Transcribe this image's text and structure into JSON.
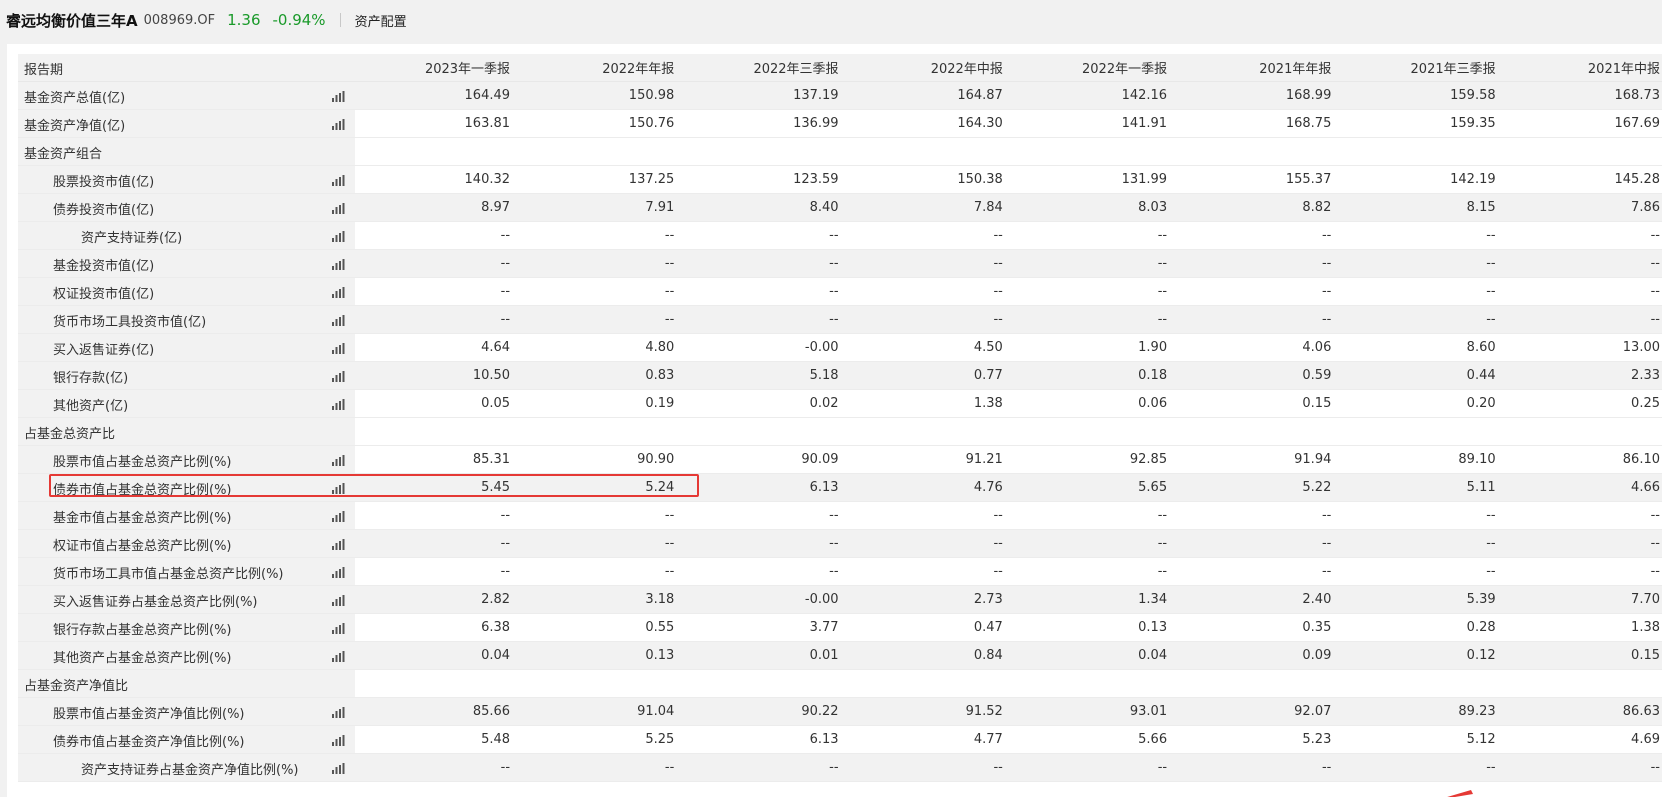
{
  "header": {
    "fund_name": "睿远均衡价值三年A",
    "fund_code": "008969.OF",
    "price": "1.36",
    "change": "-0.94%",
    "section_title": "资产配置",
    "price_color": "#1a9a2a"
  },
  "table": {
    "header_label": "报告期",
    "columns": [
      "2023年一季报",
      "2022年年报",
      "2022年三季报",
      "2022年中报",
      "2022年一季报",
      "2021年年报",
      "2021年三季报",
      "2021年中报"
    ],
    "rows": [
      {
        "label": "基金资产总值(亿)",
        "level": 0,
        "values": [
          "164.49",
          "150.98",
          "137.19",
          "164.87",
          "142.16",
          "168.99",
          "159.58",
          "168.73"
        ]
      },
      {
        "label": "基金资产净值(亿)",
        "level": 0,
        "values": [
          "163.81",
          "150.76",
          "136.99",
          "164.30",
          "141.91",
          "168.75",
          "159.35",
          "167.69"
        ]
      },
      {
        "label": "基金资产组合",
        "level": 0,
        "group": true
      },
      {
        "label": "股票投资市值(亿)",
        "level": 1,
        "values": [
          "140.32",
          "137.25",
          "123.59",
          "150.38",
          "131.99",
          "155.37",
          "142.19",
          "145.28"
        ]
      },
      {
        "label": "债券投资市值(亿)",
        "level": 1,
        "values": [
          "8.97",
          "7.91",
          "8.40",
          "7.84",
          "8.03",
          "8.82",
          "8.15",
          "7.86"
        ]
      },
      {
        "label": "资产支持证券(亿)",
        "level": 2,
        "values": [
          "--",
          "--",
          "--",
          "--",
          "--",
          "--",
          "--",
          "--"
        ]
      },
      {
        "label": "基金投资市值(亿)",
        "level": 1,
        "values": [
          "--",
          "--",
          "--",
          "--",
          "--",
          "--",
          "--",
          "--"
        ]
      },
      {
        "label": "权证投资市值(亿)",
        "level": 1,
        "values": [
          "--",
          "--",
          "--",
          "--",
          "--",
          "--",
          "--",
          "--"
        ]
      },
      {
        "label": "货币市场工具投资市值(亿)",
        "level": 1,
        "values": [
          "--",
          "--",
          "--",
          "--",
          "--",
          "--",
          "--",
          "--"
        ]
      },
      {
        "label": "买入返售证券(亿)",
        "level": 1,
        "values": [
          "4.64",
          "4.80",
          "-0.00",
          "4.50",
          "1.90",
          "4.06",
          "8.60",
          "13.00"
        ]
      },
      {
        "label": "银行存款(亿)",
        "level": 1,
        "values": [
          "10.50",
          "0.83",
          "5.18",
          "0.77",
          "0.18",
          "0.59",
          "0.44",
          "2.33"
        ]
      },
      {
        "label": "其他资产(亿)",
        "level": 1,
        "values": [
          "0.05",
          "0.19",
          "0.02",
          "1.38",
          "0.06",
          "0.15",
          "0.20",
          "0.25"
        ]
      },
      {
        "label": "占基金总资产比",
        "level": 0,
        "group": true
      },
      {
        "label": "股票市值占基金总资产比例(%)",
        "level": 1,
        "values": [
          "85.31",
          "90.90",
          "90.09",
          "91.21",
          "92.85",
          "91.94",
          "89.10",
          "86.10"
        ]
      },
      {
        "label": "债券市值占基金总资产比例(%)",
        "level": 1,
        "values": [
          "5.45",
          "5.24",
          "6.13",
          "4.76",
          "5.65",
          "5.22",
          "5.11",
          "4.66"
        ]
      },
      {
        "label": "基金市值占基金总资产比例(%)",
        "level": 1,
        "values": [
          "--",
          "--",
          "--",
          "--",
          "--",
          "--",
          "--",
          "--"
        ]
      },
      {
        "label": "权证市值占基金总资产比例(%)",
        "level": 1,
        "values": [
          "--",
          "--",
          "--",
          "--",
          "--",
          "--",
          "--",
          "--"
        ]
      },
      {
        "label": "货币市场工具市值占基金总资产比例(%)",
        "level": 1,
        "values": [
          "--",
          "--",
          "--",
          "--",
          "--",
          "--",
          "--",
          "--"
        ]
      },
      {
        "label": "买入返售证券占基金总资产比例(%)",
        "level": 1,
        "values": [
          "2.82",
          "3.18",
          "-0.00",
          "2.73",
          "1.34",
          "2.40",
          "5.39",
          "7.70"
        ]
      },
      {
        "label": "银行存款占基金总资产比例(%)",
        "level": 1,
        "values": [
          "6.38",
          "0.55",
          "3.77",
          "0.47",
          "0.13",
          "0.35",
          "0.28",
          "1.38"
        ]
      },
      {
        "label": "其他资产占基金总资产比例(%)",
        "level": 1,
        "values": [
          "0.04",
          "0.13",
          "0.01",
          "0.84",
          "0.04",
          "0.09",
          "0.12",
          "0.15"
        ]
      },
      {
        "label": "占基金资产净值比",
        "level": 0,
        "group": true
      },
      {
        "label": "股票市值占基金资产净值比例(%)",
        "level": 1,
        "values": [
          "85.66",
          "91.04",
          "90.22",
          "91.52",
          "93.01",
          "92.07",
          "89.23",
          "86.63"
        ]
      },
      {
        "label": "债券市值占基金资产净值比例(%)",
        "level": 1,
        "values": [
          "5.48",
          "5.25",
          "6.13",
          "4.77",
          "5.66",
          "5.23",
          "5.12",
          "4.69"
        ]
      },
      {
        "label": "资产支持证券占基金资产净值比例(%)",
        "level": 2,
        "values": [
          "--",
          "--",
          "--",
          "--",
          "--",
          "--",
          "--",
          "--"
        ]
      }
    ]
  },
  "highlight_color": "#e53935"
}
